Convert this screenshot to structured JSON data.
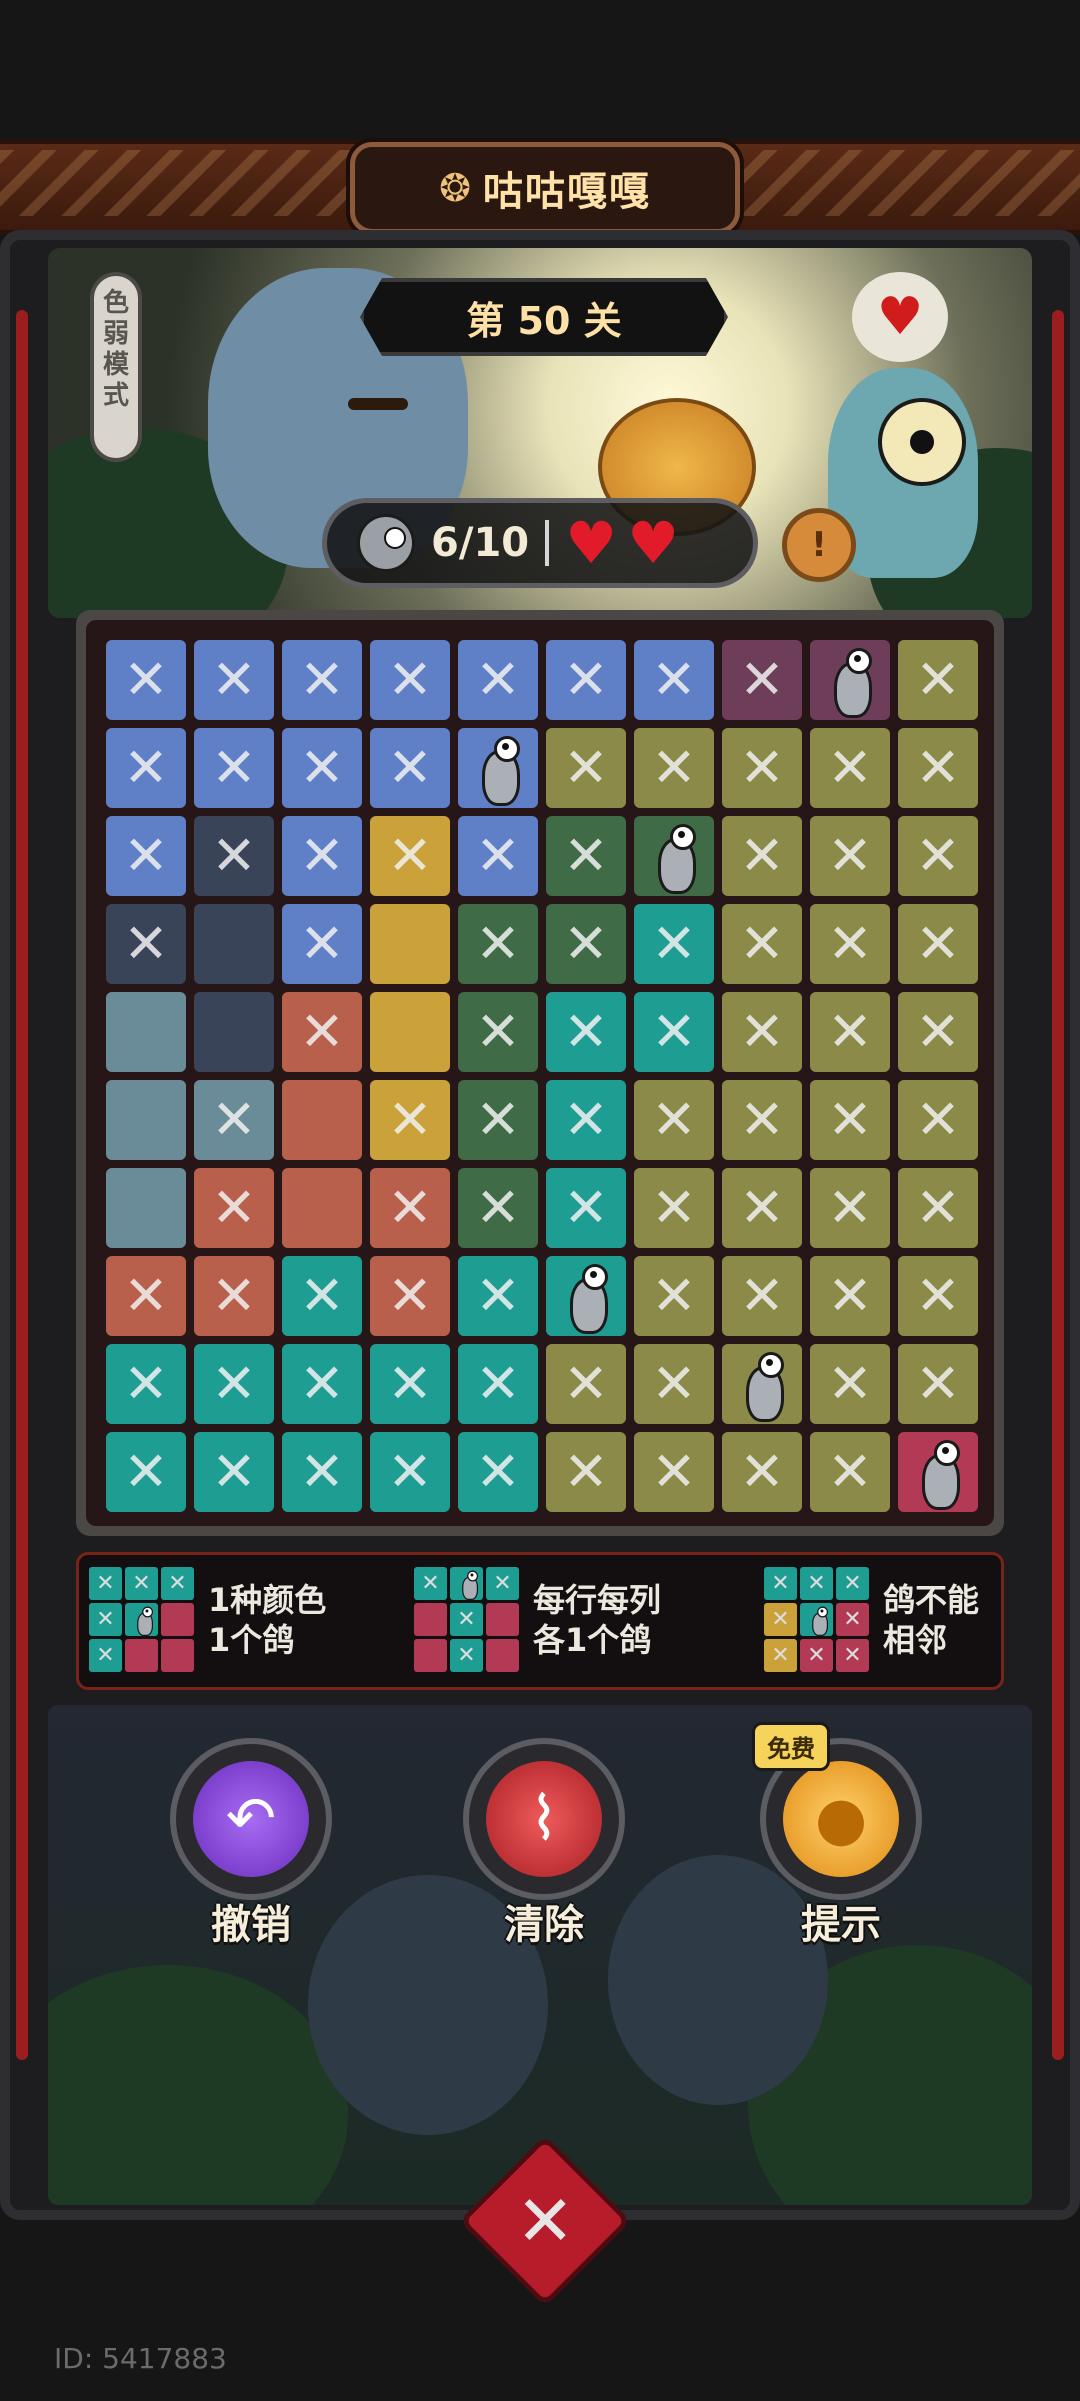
{
  "header": {
    "title": "咕咕嘎嘎",
    "icon": "bird-emblem-icon"
  },
  "level": {
    "label": "第 50 关"
  },
  "colorblind_mode": {
    "label": "色弱模式"
  },
  "status": {
    "pigeons_found": "6/10",
    "lives": 2,
    "heart_icon": "heart-icon"
  },
  "info": {
    "label": "!"
  },
  "palette": {
    "blue": "#5f7fc7",
    "slate": "#3a4458",
    "gold": "#caa239",
    "pine": "#3f6b46",
    "teal": "#1e9e93",
    "olive": "#8b8a48",
    "grey": "#6a8b98",
    "salmon": "#b8604c",
    "plum": "#6e3d5a",
    "crimson": "#b23a55"
  },
  "board": {
    "size": 10,
    "rows": [
      [
        {
          "c": "blue",
          "m": "x"
        },
        {
          "c": "blue",
          "m": "x"
        },
        {
          "c": "blue",
          "m": "x"
        },
        {
          "c": "blue",
          "m": "x"
        },
        {
          "c": "blue",
          "m": "x"
        },
        {
          "c": "blue",
          "m": "x"
        },
        {
          "c": "blue",
          "m": "x"
        },
        {
          "c": "plum",
          "m": "x"
        },
        {
          "c": "plum",
          "m": "pigeon"
        },
        {
          "c": "olive",
          "m": "x"
        }
      ],
      [
        {
          "c": "blue",
          "m": "x"
        },
        {
          "c": "blue",
          "m": "x"
        },
        {
          "c": "blue",
          "m": "x"
        },
        {
          "c": "blue",
          "m": "x"
        },
        {
          "c": "blue",
          "m": "pigeon"
        },
        {
          "c": "olive",
          "m": "x"
        },
        {
          "c": "olive",
          "m": "x"
        },
        {
          "c": "olive",
          "m": "x"
        },
        {
          "c": "olive",
          "m": "x"
        },
        {
          "c": "olive",
          "m": "x"
        }
      ],
      [
        {
          "c": "blue",
          "m": "x"
        },
        {
          "c": "slate",
          "m": "x"
        },
        {
          "c": "blue",
          "m": "x"
        },
        {
          "c": "gold",
          "m": "x"
        },
        {
          "c": "blue",
          "m": "x"
        },
        {
          "c": "pine",
          "m": "x"
        },
        {
          "c": "pine",
          "m": "pigeon"
        },
        {
          "c": "olive",
          "m": "x"
        },
        {
          "c": "olive",
          "m": "x"
        },
        {
          "c": "olive",
          "m": "x"
        }
      ],
      [
        {
          "c": "slate",
          "m": "x"
        },
        {
          "c": "slate",
          "m": ""
        },
        {
          "c": "blue",
          "m": "x"
        },
        {
          "c": "gold",
          "m": ""
        },
        {
          "c": "pine",
          "m": "x"
        },
        {
          "c": "pine",
          "m": "x"
        },
        {
          "c": "teal",
          "m": "x"
        },
        {
          "c": "olive",
          "m": "x"
        },
        {
          "c": "olive",
          "m": "x"
        },
        {
          "c": "olive",
          "m": "x"
        }
      ],
      [
        {
          "c": "grey",
          "m": ""
        },
        {
          "c": "slate",
          "m": ""
        },
        {
          "c": "salmon",
          "m": "x"
        },
        {
          "c": "gold",
          "m": ""
        },
        {
          "c": "pine",
          "m": "x"
        },
        {
          "c": "teal",
          "m": "x"
        },
        {
          "c": "teal",
          "m": "x"
        },
        {
          "c": "olive",
          "m": "x"
        },
        {
          "c": "olive",
          "m": "x"
        },
        {
          "c": "olive",
          "m": "x"
        }
      ],
      [
        {
          "c": "grey",
          "m": ""
        },
        {
          "c": "grey",
          "m": "x"
        },
        {
          "c": "salmon",
          "m": ""
        },
        {
          "c": "gold",
          "m": "x"
        },
        {
          "c": "pine",
          "m": "x"
        },
        {
          "c": "teal",
          "m": "x"
        },
        {
          "c": "olive",
          "m": "x"
        },
        {
          "c": "olive",
          "m": "x"
        },
        {
          "c": "olive",
          "m": "x"
        },
        {
          "c": "olive",
          "m": "x"
        }
      ],
      [
        {
          "c": "grey",
          "m": ""
        },
        {
          "c": "salmon",
          "m": "x"
        },
        {
          "c": "salmon",
          "m": ""
        },
        {
          "c": "salmon",
          "m": "x"
        },
        {
          "c": "pine",
          "m": "x"
        },
        {
          "c": "teal",
          "m": "x"
        },
        {
          "c": "olive",
          "m": "x"
        },
        {
          "c": "olive",
          "m": "x"
        },
        {
          "c": "olive",
          "m": "x"
        },
        {
          "c": "olive",
          "m": "x"
        }
      ],
      [
        {
          "c": "salmon",
          "m": "x"
        },
        {
          "c": "salmon",
          "m": "x"
        },
        {
          "c": "teal",
          "m": "x"
        },
        {
          "c": "salmon",
          "m": "x"
        },
        {
          "c": "teal",
          "m": "x"
        },
        {
          "c": "teal",
          "m": "pigeon"
        },
        {
          "c": "olive",
          "m": "x"
        },
        {
          "c": "olive",
          "m": "x"
        },
        {
          "c": "olive",
          "m": "x"
        },
        {
          "c": "olive",
          "m": "x"
        }
      ],
      [
        {
          "c": "teal",
          "m": "x"
        },
        {
          "c": "teal",
          "m": "x"
        },
        {
          "c": "teal",
          "m": "x"
        },
        {
          "c": "teal",
          "m": "x"
        },
        {
          "c": "teal",
          "m": "x"
        },
        {
          "c": "olive",
          "m": "x"
        },
        {
          "c": "olive",
          "m": "x"
        },
        {
          "c": "olive",
          "m": "pigeon"
        },
        {
          "c": "olive",
          "m": "x"
        },
        {
          "c": "olive",
          "m": "x"
        }
      ],
      [
        {
          "c": "teal",
          "m": "x"
        },
        {
          "c": "teal",
          "m": "x"
        },
        {
          "c": "teal",
          "m": "x"
        },
        {
          "c": "teal",
          "m": "x"
        },
        {
          "c": "teal",
          "m": "x"
        },
        {
          "c": "olive",
          "m": "x"
        },
        {
          "c": "olive",
          "m": "x"
        },
        {
          "c": "olive",
          "m": "x"
        },
        {
          "c": "olive",
          "m": "x"
        },
        {
          "c": "crimson",
          "m": "pigeon"
        }
      ]
    ]
  },
  "rules": [
    {
      "text": [
        "1种颜色",
        "1个鸽"
      ],
      "mini": [
        [
          "teal",
          "x"
        ],
        [
          "teal",
          "x"
        ],
        [
          "teal",
          "x"
        ],
        [
          "teal",
          "x"
        ],
        [
          "teal",
          "pigeon"
        ],
        [
          "crimson",
          ""
        ],
        [
          "teal",
          "x"
        ],
        [
          "crimson",
          ""
        ],
        [
          "crimson",
          ""
        ]
      ]
    },
    {
      "text": [
        "每行每列",
        "各1个鸽"
      ],
      "mini": [
        [
          "teal",
          "x"
        ],
        [
          "teal",
          "pigeon"
        ],
        [
          "teal",
          "x"
        ],
        [
          "crimson",
          ""
        ],
        [
          "teal",
          "x"
        ],
        [
          "crimson",
          ""
        ],
        [
          "crimson",
          ""
        ],
        [
          "teal",
          "x"
        ],
        [
          "crimson",
          ""
        ]
      ]
    },
    {
      "text": [
        "鸽不能",
        "相邻"
      ],
      "mini": [
        [
          "teal",
          "x"
        ],
        [
          "teal",
          "x"
        ],
        [
          "teal",
          "x"
        ],
        [
          "gold",
          "x"
        ],
        [
          "teal",
          "pigeon"
        ],
        [
          "crimson",
          "x"
        ],
        [
          "gold",
          "x"
        ],
        [
          "crimson",
          "x"
        ],
        [
          "crimson",
          "x"
        ]
      ]
    }
  ],
  "actions": {
    "undo": {
      "label": "撤销",
      "icon": "undo-arrow-icon"
    },
    "clear": {
      "label": "清除",
      "icon": "broom-icon"
    },
    "hint": {
      "label": "提示",
      "icon": "lightbulb-icon",
      "badge": "免费"
    }
  },
  "close": {
    "icon": "close-x-icon"
  },
  "footer": {
    "id_text": "ID: 5417883"
  }
}
